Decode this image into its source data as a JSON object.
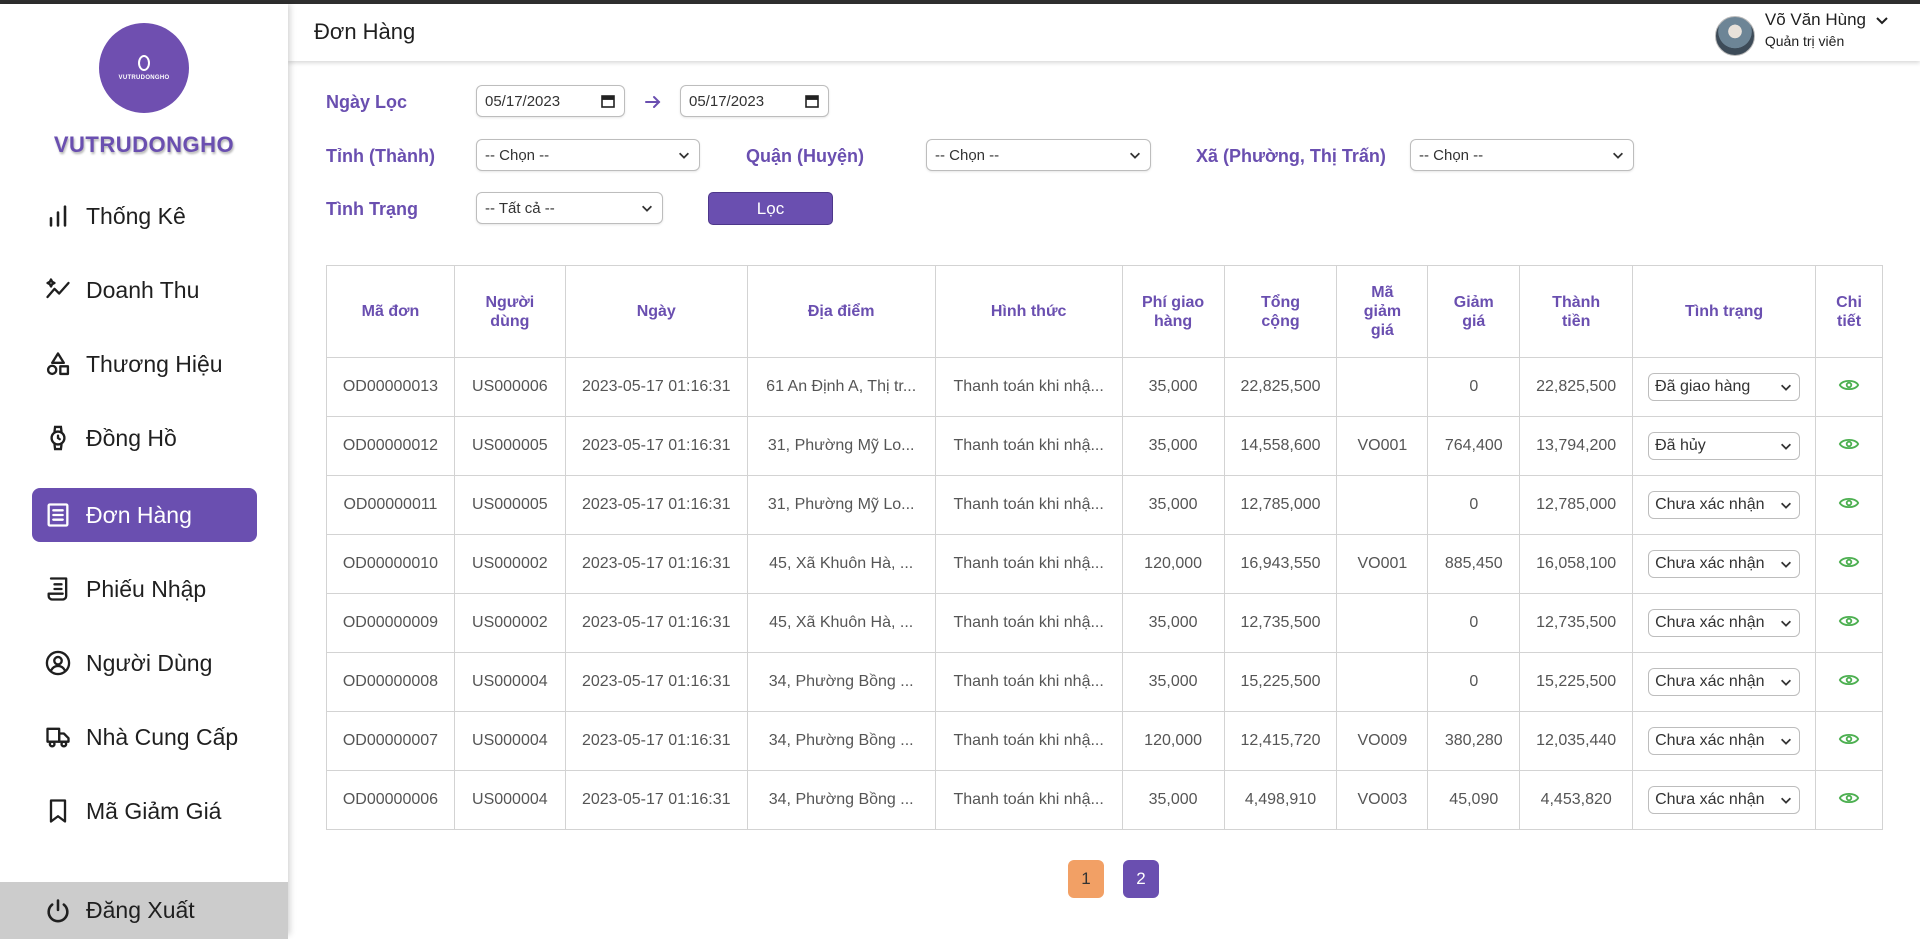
{
  "brand": {
    "name": "VUTRUDONGHO",
    "logo_text": "VUTRUDONGHO"
  },
  "sidebar": {
    "items": [
      {
        "label": "Thống Kê",
        "icon": "bar-chart-icon"
      },
      {
        "label": "Doanh Thu",
        "icon": "sparkle-trend-icon"
      },
      {
        "label": "Thương Hiệu",
        "icon": "shapes-icon"
      },
      {
        "label": "Đồng Hồ",
        "icon": "watch-icon"
      },
      {
        "label": "Đơn Hàng",
        "icon": "list-icon",
        "active": true
      },
      {
        "label": "Phiếu Nhập",
        "icon": "receipt-icon"
      },
      {
        "label": "Người Dùng",
        "icon": "user-circle-icon"
      },
      {
        "label": "Nhà Cung Cấp",
        "icon": "truck-icon"
      },
      {
        "label": "Mã Giảm Giá",
        "icon": "bookmark-icon"
      }
    ],
    "logout": "Đăng Xuất"
  },
  "header": {
    "title": "Đơn Hàng",
    "user_name": "Võ Văn Hùng",
    "user_role": "Quản trị viên"
  },
  "filters": {
    "date_label": "Ngày Lọc",
    "date_from": "05/17/2023",
    "date_to": "05/17/2023",
    "province_label": "Tỉnh (Thành)",
    "province_value": "-- Chọn --",
    "district_label": "Quận (Huyện)",
    "district_value": "-- Chọn --",
    "ward_label": "Xã (Phường, Thị Trấn)",
    "ward_value": "-- Chọn --",
    "status_label": "Tình Trạng",
    "status_value": "-- Tất cả --",
    "filter_button": "Lọc"
  },
  "table": {
    "headers": [
      "Mã đơn",
      "Người dùng",
      "Ngày",
      "Địa điểm",
      "Hình thức",
      "Phí giao hàng",
      "Tổng cộng",
      "Mã giảm giá",
      "Giảm giá",
      "Thành tiền",
      "Tình trạng",
      "Chi tiết"
    ],
    "rows": [
      {
        "id": "OD00000013",
        "user": "US000006",
        "date": "2023-05-17 01:16:31",
        "location": "61 An Định A, Thị tr...",
        "method": "Thanh toán khi nhậ...",
        "shipping": "35,000",
        "total": "22,825,500",
        "voucher": "",
        "discount": "0",
        "final": "22,825,500",
        "status": "Đã giao hàng"
      },
      {
        "id": "OD00000012",
        "user": "US000005",
        "date": "2023-05-17 01:16:31",
        "location": "31, Phường Mỹ Lo...",
        "method": "Thanh toán khi nhậ...",
        "shipping": "35,000",
        "total": "14,558,600",
        "voucher": "VO001",
        "discount": "764,400",
        "final": "13,794,200",
        "status": "Đã hủy"
      },
      {
        "id": "OD00000011",
        "user": "US000005",
        "date": "2023-05-17 01:16:31",
        "location": "31, Phường Mỹ Lo...",
        "method": "Thanh toán khi nhậ...",
        "shipping": "35,000",
        "total": "12,785,000",
        "voucher": "",
        "discount": "0",
        "final": "12,785,000",
        "status": "Chưa xác nhận"
      },
      {
        "id": "OD00000010",
        "user": "US000002",
        "date": "2023-05-17 01:16:31",
        "location": "45, Xã Khuôn Hà, ...",
        "method": "Thanh toán khi nhậ...",
        "shipping": "120,000",
        "total": "16,943,550",
        "voucher": "VO001",
        "discount": "885,450",
        "final": "16,058,100",
        "status": "Chưa xác nhận"
      },
      {
        "id": "OD00000009",
        "user": "US000002",
        "date": "2023-05-17 01:16:31",
        "location": "45, Xã Khuôn Hà, ...",
        "method": "Thanh toán khi nhậ...",
        "shipping": "35,000",
        "total": "12,735,500",
        "voucher": "",
        "discount": "0",
        "final": "12,735,500",
        "status": "Chưa xác nhận"
      },
      {
        "id": "OD00000008",
        "user": "US000004",
        "date": "2023-05-17 01:16:31",
        "location": "34, Phường Bồng ...",
        "method": "Thanh toán khi nhậ...",
        "shipping": "35,000",
        "total": "15,225,500",
        "voucher": "",
        "discount": "0",
        "final": "15,225,500",
        "status": "Chưa xác nhận"
      },
      {
        "id": "OD00000007",
        "user": "US000004",
        "date": "2023-05-17 01:16:31",
        "location": "34, Phường Bồng ...",
        "method": "Thanh toán khi nhậ...",
        "shipping": "120,000",
        "total": "12,415,720",
        "voucher": "VO009",
        "discount": "380,280",
        "final": "12,035,440",
        "status": "Chưa xác nhận"
      },
      {
        "id": "OD00000006",
        "user": "US000004",
        "date": "2023-05-17 01:16:31",
        "location": "34, Phường Bồng ...",
        "method": "Thanh toán khi nhậ...",
        "shipping": "35,000",
        "total": "4,498,910",
        "voucher": "VO003",
        "discount": "45,090",
        "final": "4,453,820",
        "status": "Chưa xác nhận"
      }
    ]
  },
  "pagination": {
    "pages": [
      "1",
      "2"
    ],
    "current": "2"
  },
  "colors": {
    "accent": "#6a4fb0",
    "page_highlight": "#f2a065",
    "eye": "#4caf50"
  }
}
